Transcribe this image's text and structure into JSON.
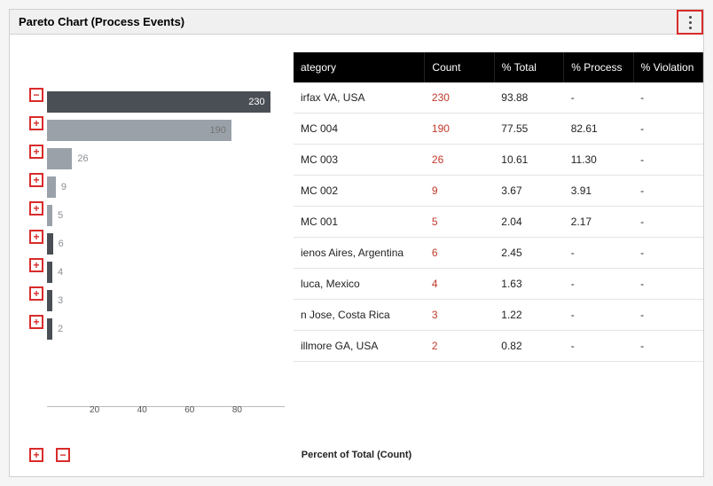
{
  "title": "Pareto Chart (Process Events)",
  "x_axis_title": "Percent of Total (Count)",
  "x_ticks": [
    20,
    40,
    60,
    80
  ],
  "expand_buttons": [
    "−",
    "+",
    "+",
    "+",
    "+",
    "+",
    "+",
    "+",
    "+"
  ],
  "footer_buttons": [
    "+",
    "−"
  ],
  "table": {
    "columns": [
      "ategory",
      "Count",
      "% Total",
      "% Process",
      "% Violation"
    ],
    "rows": [
      {
        "category": "irfax VA, USA",
        "count": "230",
        "pct_total": "93.88",
        "pct_process": "-",
        "pct_violation": "-"
      },
      {
        "category": "MC 004",
        "count": "190",
        "pct_total": "77.55",
        "pct_process": "82.61",
        "pct_violation": "-"
      },
      {
        "category": "MC 003",
        "count": "26",
        "pct_total": "10.61",
        "pct_process": "11.30",
        "pct_violation": "-"
      },
      {
        "category": "MC 002",
        "count": "9",
        "pct_total": "3.67",
        "pct_process": "3.91",
        "pct_violation": "-"
      },
      {
        "category": "MC 001",
        "count": "5",
        "pct_total": "2.04",
        "pct_process": "2.17",
        "pct_violation": "-"
      },
      {
        "category": "ienos Aires, Argentina",
        "count": "6",
        "pct_total": "2.45",
        "pct_process": "-",
        "pct_violation": "-"
      },
      {
        "category": "luca, Mexico",
        "count": "4",
        "pct_total": "1.63",
        "pct_process": "-",
        "pct_violation": "-"
      },
      {
        "category": "n Jose, Costa Rica",
        "count": "3",
        "pct_total": "1.22",
        "pct_process": "-",
        "pct_violation": "-"
      },
      {
        "category": "illmore GA, USA",
        "count": "2",
        "pct_total": "0.82",
        "pct_process": "-",
        "pct_violation": "-"
      }
    ]
  },
  "chart_data": {
    "type": "bar",
    "orientation": "horizontal",
    "title": "Pareto Chart (Process Events)",
    "xlabel": "Percent of Total (Count)",
    "xlim": [
      0,
      100
    ],
    "bars": [
      {
        "label": "irfax VA, USA",
        "value": 230,
        "pct_of_total": 93.88,
        "style": "dark"
      },
      {
        "label": "MC 004",
        "value": 190,
        "pct_of_total": 77.55,
        "style": "light"
      },
      {
        "label": "MC 003",
        "value": 26,
        "pct_of_total": 10.61,
        "style": "light"
      },
      {
        "label": "MC 002",
        "value": 9,
        "pct_of_total": 3.67,
        "style": "light"
      },
      {
        "label": "MC 001",
        "value": 5,
        "pct_of_total": 2.04,
        "style": "light"
      },
      {
        "label": "ienos Aires, Argentina",
        "value": 6,
        "pct_of_total": 2.45,
        "style": "dark"
      },
      {
        "label": "luca, Mexico",
        "value": 4,
        "pct_of_total": 1.63,
        "style": "dark"
      },
      {
        "label": "n Jose, Costa Rica",
        "value": 3,
        "pct_of_total": 1.22,
        "style": "dark"
      },
      {
        "label": "illmore GA, USA",
        "value": 2,
        "pct_of_total": 0.82,
        "style": "dark"
      }
    ]
  }
}
